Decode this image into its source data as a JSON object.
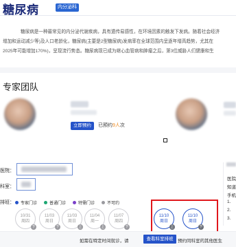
{
  "header": {
    "title": "糖尿病",
    "tag": "内分泌科"
  },
  "intro": {
    "line1": "糖尿病是一种最常见的内分泌代谢疾病，具有遗传易感性，在环境因素的触发下发病。随着社会经济",
    "line2": "增加和运动减少等)及人口老龄化，糖尿病(主要是2型糖尿病)发病率在全球范围内呈逐年增高趋势，尤其在",
    "line3": "2025年可能增加170%)，呈现流行势态。糖尿病现已成为继心血管病和肿瘤之后，第3位威胁人们健康和生"
  },
  "experts": {
    "section_title": "专家团队",
    "book_button": "立即预约",
    "booked_prefix": "已预约",
    "booked_count": "9人",
    "booked_suffix": "次"
  },
  "form": {
    "hospital_label": "医院：",
    "dept_label": "科室：",
    "schedule_label": "排班："
  },
  "legend": {
    "expert": "专家门诊",
    "general": "普通门诊",
    "special": "特需门诊",
    "unavailable": "不可约",
    "colors": {
      "expert": "#2553c9",
      "general": "#1ca672",
      "special": "#7a3fc9",
      "unavailable": "#9a9a9f"
    }
  },
  "days": [
    {
      "date": "10/31",
      "week": "周四",
      "badge": "下",
      "active": false
    },
    {
      "date": "11/03",
      "week": "周日",
      "badge": "下",
      "active": false
    },
    {
      "date": "11/03",
      "week": "周日",
      "badge": "上",
      "active": false
    },
    {
      "date": "11/04",
      "week": "周一",
      "badge": "上",
      "active": false
    },
    {
      "date": "11/07",
      "week": "周四",
      "badge": "下",
      "active": false
    },
    {
      "date": "11/10",
      "week": "周日",
      "badge": "上",
      "active": true
    },
    {
      "date": "11/10",
      "week": "周日",
      "badge": "下",
      "active": true
    }
  ],
  "right_panel": {
    "line1": "医院",
    "line2": "知道",
    "line3": "手机",
    "line4": "1. ",
    "line5": "2. ",
    "line6": "3. "
  },
  "bottom": {
    "prefix": "如需在特定时间就诊，请",
    "button": "查看科室排班",
    "suffix": "预约同科室的其他医生"
  }
}
